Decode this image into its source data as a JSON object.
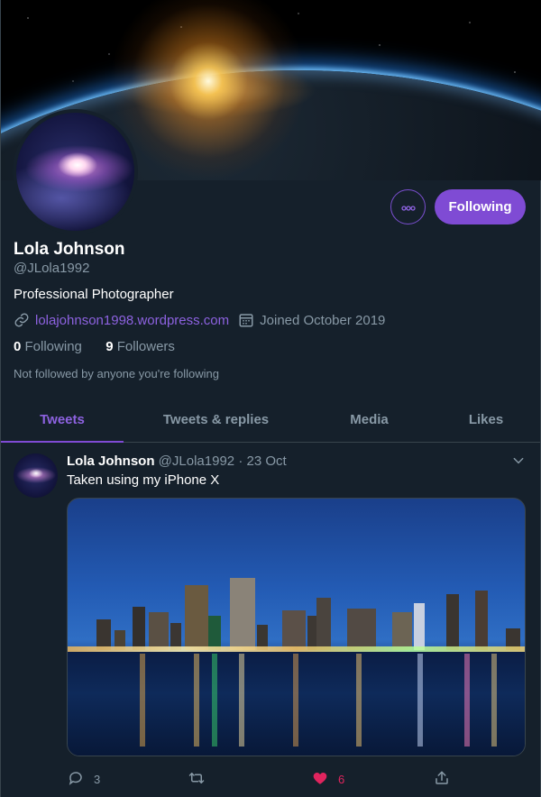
{
  "profile": {
    "name": "Lola Johnson",
    "handle": "@JLola1992",
    "bio": "Professional Photographer",
    "website": "lolajohnson1998.wordpress.com",
    "joined": "Joined October 2019",
    "following_count": "0",
    "following_label": "Following",
    "followers_count": "9",
    "followers_label": "Followers",
    "not_followed_note": "Not followed by anyone you're following"
  },
  "buttons": {
    "more_icon": "more-dots-icon",
    "follow_label": "Following"
  },
  "tabs": [
    {
      "label": "Tweets",
      "active": true
    },
    {
      "label": "Tweets & replies",
      "active": false
    },
    {
      "label": "Media",
      "active": false
    },
    {
      "label": "Likes",
      "active": false
    }
  ],
  "tweet": {
    "author": "Lola Johnson",
    "handle": "@JLola1992",
    "separator": "·",
    "date": "23 Oct",
    "text": "Taken using my iPhone X",
    "replies": "3",
    "retweets": "",
    "likes": "6",
    "liked": true
  },
  "colors": {
    "background": "#15202b",
    "accent": "#7f4bd4",
    "link": "#8d62e0",
    "secondary_text": "#8899a6",
    "like": "#e0245e",
    "border": "#38444d"
  }
}
